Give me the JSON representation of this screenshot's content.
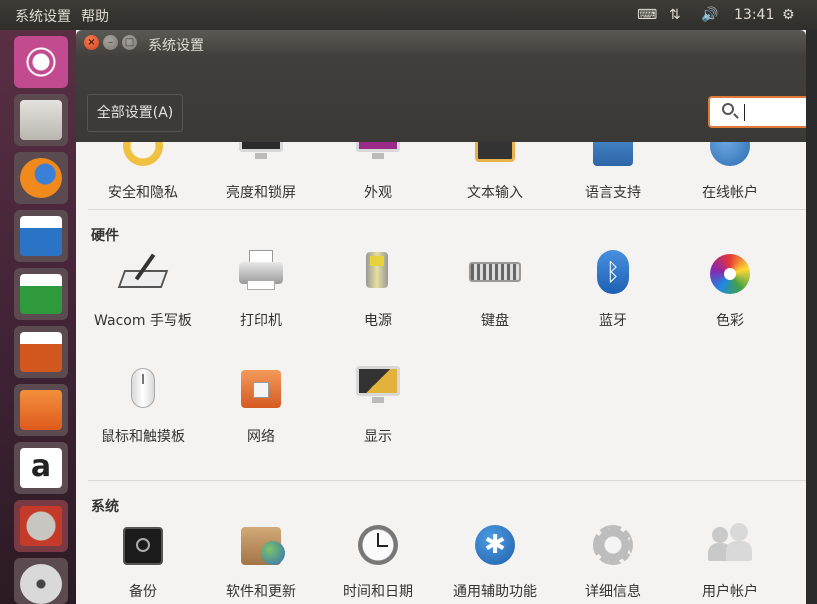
{
  "top_panel": {
    "app_title": "系统设置",
    "menu_help": "帮助",
    "clock": "13:41"
  },
  "window": {
    "title": "系统设置",
    "all_settings_label": "全部设置(A)",
    "search_value": ""
  },
  "sections": {
    "personal": {
      "items": [
        {
          "label": "安全和隐私",
          "icon": "security-icon"
        },
        {
          "label": "亮度和锁屏",
          "icon": "brightness-icon"
        },
        {
          "label": "外观",
          "icon": "appearance-icon"
        },
        {
          "label": "文本输入",
          "icon": "text-entry-icon"
        },
        {
          "label": "语言支持",
          "icon": "language-icon"
        },
        {
          "label": "在线帐户",
          "icon": "online-accounts-icon"
        }
      ]
    },
    "hardware": {
      "title": "硬件",
      "items": [
        {
          "label": "Wacom 手写板",
          "icon": "wacom-icon"
        },
        {
          "label": "打印机",
          "icon": "printer-icon"
        },
        {
          "label": "电源",
          "icon": "power-icon"
        },
        {
          "label": "键盘",
          "icon": "keyboard-icon"
        },
        {
          "label": "蓝牙",
          "icon": "bluetooth-icon"
        },
        {
          "label": "色彩",
          "icon": "color-icon"
        },
        {
          "label": "鼠标和触摸板",
          "icon": "mouse-icon"
        },
        {
          "label": "网络",
          "icon": "network-icon"
        },
        {
          "label": "显示",
          "icon": "display-icon"
        }
      ]
    },
    "system": {
      "title": "系统",
      "items": [
        {
          "label": "备份",
          "icon": "backup-icon"
        },
        {
          "label": "软件和更新",
          "icon": "software-updates-icon"
        },
        {
          "label": "时间和日期",
          "icon": "time-date-icon"
        },
        {
          "label": "通用辅助功能",
          "icon": "accessibility-icon"
        },
        {
          "label": "详细信息",
          "icon": "details-icon"
        },
        {
          "label": "用户帐户",
          "icon": "user-accounts-icon"
        }
      ]
    }
  },
  "colors": {
    "accent": "#e07a3c",
    "launcher_top": "#5a2f44"
  }
}
